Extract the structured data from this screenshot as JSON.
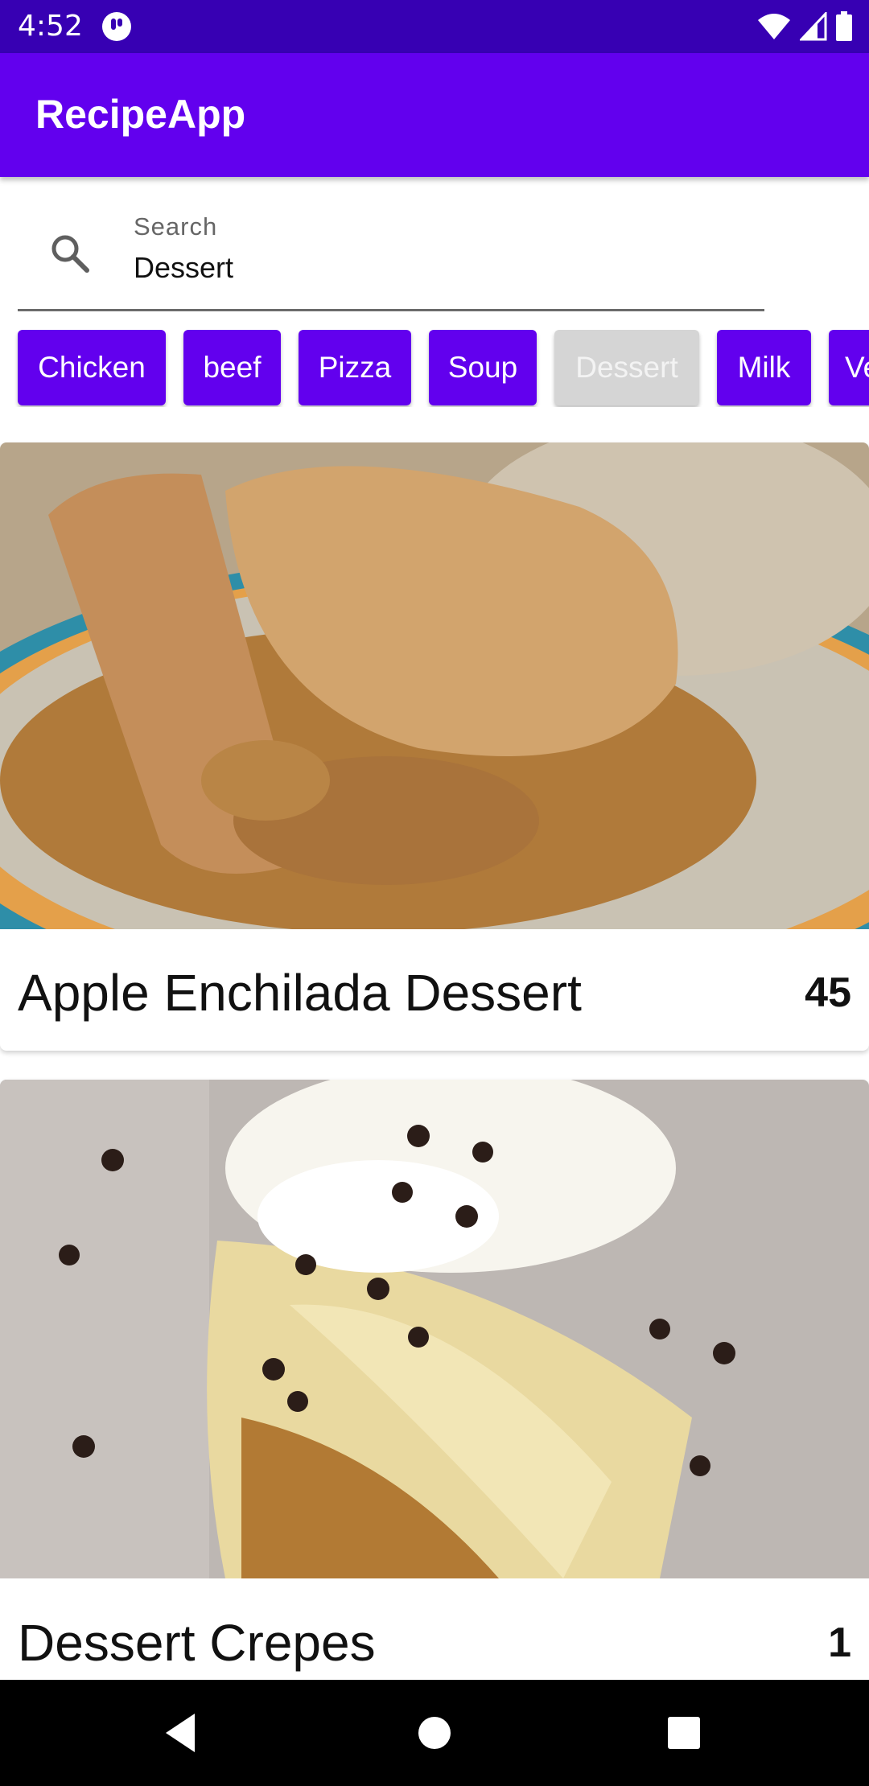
{
  "status_bar": {
    "time": "4:52",
    "icons": [
      "notification-app-icon",
      "wifi-icon",
      "signal-icon",
      "battery-icon"
    ]
  },
  "app_bar": {
    "title": "RecipeApp"
  },
  "search": {
    "label": "Search",
    "value": "Dessert",
    "icon": "search-icon"
  },
  "chips": [
    {
      "label": "Chicken",
      "selected": false
    },
    {
      "label": "beef",
      "selected": false
    },
    {
      "label": "Pizza",
      "selected": false
    },
    {
      "label": "Soup",
      "selected": false
    },
    {
      "label": "Dessert",
      "selected": true
    },
    {
      "label": "Milk",
      "selected": false
    },
    {
      "label": "Ve",
      "selected": false
    }
  ],
  "recipes": [
    {
      "title": "Apple Enchilada Dessert",
      "rating": "45"
    },
    {
      "title": "Dessert Crepes",
      "rating": "1"
    }
  ],
  "nav": {
    "buttons": [
      "back-icon",
      "home-icon",
      "recents-icon"
    ]
  },
  "colors": {
    "primary": "#6200EE",
    "primary_dark": "#3700B3",
    "chip_selected": "#d5d5d5"
  }
}
